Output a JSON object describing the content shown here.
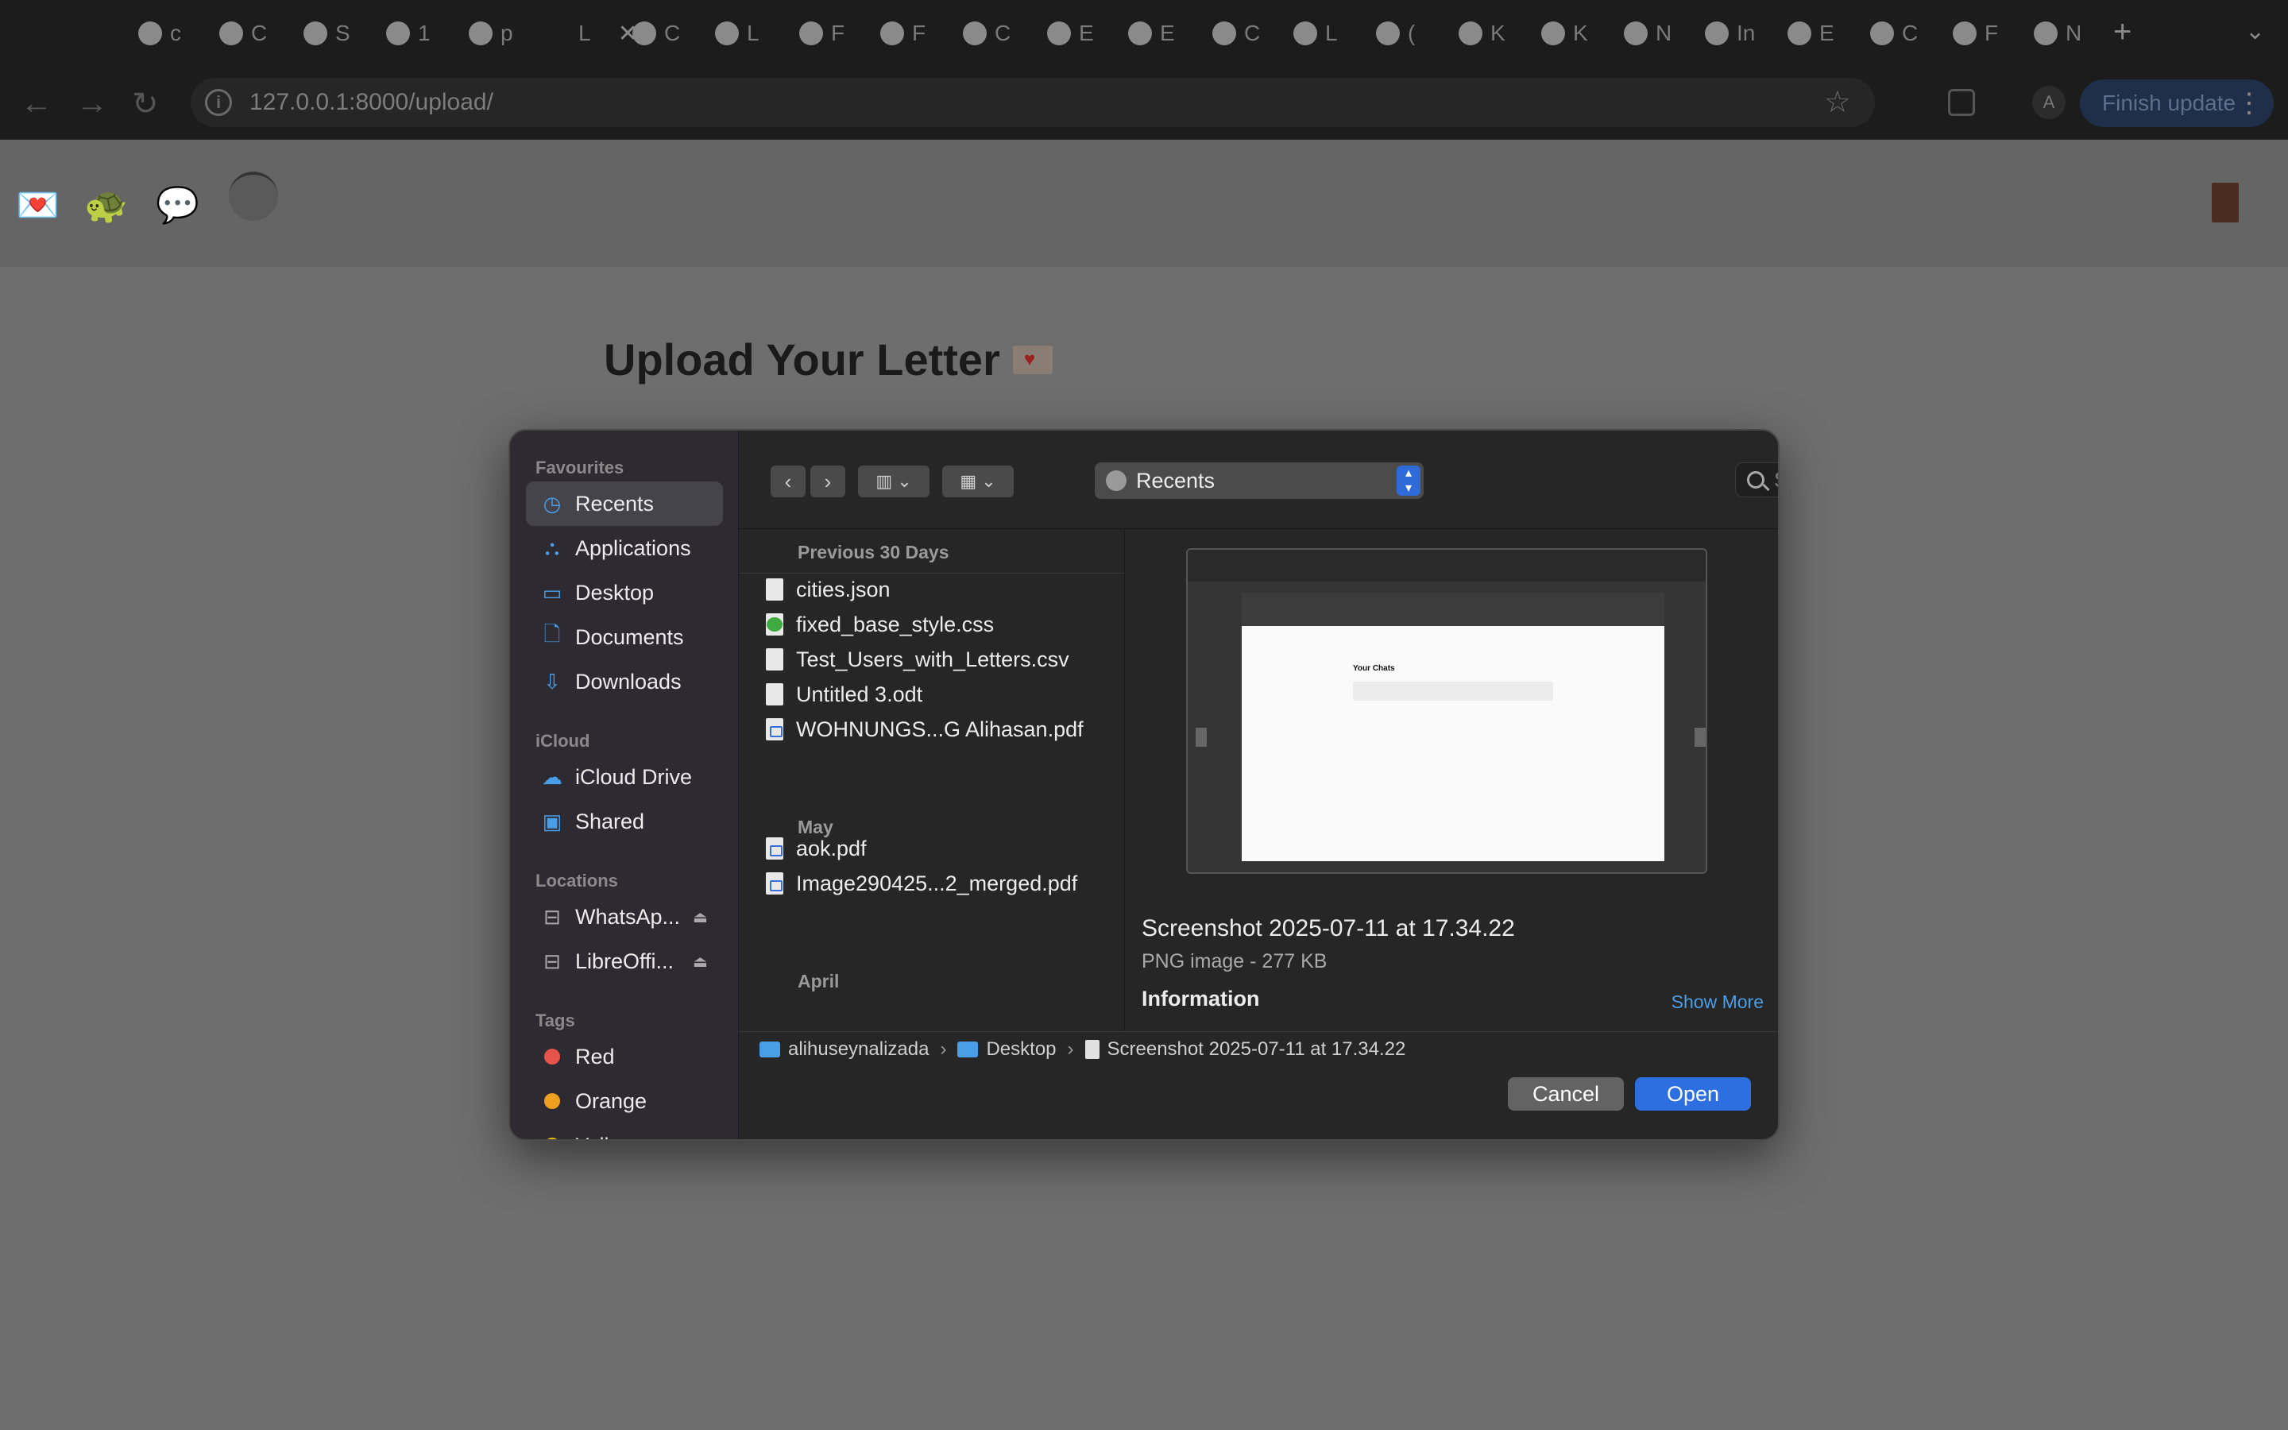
{
  "browser": {
    "tabs": [
      {
        "initial": "c"
      },
      {
        "initial": "C"
      },
      {
        "initial": "S"
      },
      {
        "initial": "1"
      },
      {
        "initial": "p"
      },
      {
        "initial": "L"
      },
      {
        "initial": "C"
      },
      {
        "initial": "L"
      },
      {
        "initial": "F"
      },
      {
        "initial": "F"
      },
      {
        "initial": "C"
      },
      {
        "initial": "E"
      },
      {
        "initial": "E"
      },
      {
        "initial": "C"
      },
      {
        "initial": "L"
      },
      {
        "initial": "("
      },
      {
        "initial": "K"
      },
      {
        "initial": "K"
      },
      {
        "initial": "N"
      },
      {
        "initial": "In"
      },
      {
        "initial": "E"
      },
      {
        "initial": "C"
      },
      {
        "initial": "F"
      },
      {
        "initial": "N"
      }
    ],
    "active_tab_close": "✕",
    "new_tab": "+",
    "tab_menu": "⌄",
    "back": "←",
    "forward": "→",
    "reload": "↻",
    "url": "127.0.0.1:8000/upload/",
    "site_info_icon": "i",
    "bookmark_star": "☆",
    "profile_initial": "A",
    "finish_update_label": "Finish update",
    "menu_dots": "⋮"
  },
  "page": {
    "title": "Upload Your Letter"
  },
  "dialog": {
    "sidebar": {
      "favourites_heading": "Favourites",
      "favourites": [
        {
          "label": "Recents",
          "icon": "clock-icon",
          "glyph": "◷"
        },
        {
          "label": "Applications",
          "icon": "applications-icon",
          "glyph": "⛬"
        },
        {
          "label": "Desktop",
          "icon": "desktop-icon",
          "glyph": "▭"
        },
        {
          "label": "Documents",
          "icon": "documents-icon",
          "glyph": "🗋"
        },
        {
          "label": "Downloads",
          "icon": "downloads-icon",
          "glyph": "⇩"
        }
      ],
      "icloud_heading": "iCloud",
      "icloud": [
        {
          "label": "iCloud Drive",
          "icon": "cloud-icon",
          "glyph": "☁"
        },
        {
          "label": "Shared",
          "icon": "shared-folder-icon",
          "glyph": "▣"
        }
      ],
      "locations_heading": "Locations",
      "locations": [
        {
          "label": "WhatsAp...",
          "icon": "drive-icon",
          "glyph": "⊟",
          "eject": "⏏"
        },
        {
          "label": "LibreOffi...",
          "icon": "drive-icon",
          "glyph": "⊟",
          "eject": "⏏"
        }
      ],
      "tags_heading": "Tags",
      "tags": [
        {
          "label": "Red",
          "color": "#e5534b"
        },
        {
          "label": "Orange",
          "color": "#f0a020"
        },
        {
          "label": "Yellow",
          "color": "#f2c200"
        }
      ]
    },
    "toolbar": {
      "back": "‹",
      "forward": "›",
      "column_view": "▥ ⌄",
      "group_view": "▦ ⌄",
      "location": "Recents",
      "location_arrows": "▴\n▾",
      "search_placeholder": "Search"
    },
    "files": {
      "groups": [
        {
          "heading": "Previous 30 Days",
          "items": [
            {
              "name": "cities.json",
              "type": "doc"
            },
            {
              "name": "fixed_base_style.css",
              "type": "css"
            },
            {
              "name": "Test_Users_with_Letters.csv",
              "type": "doc"
            },
            {
              "name": "Untitled 3.odt",
              "type": "doc"
            },
            {
              "name": "WOHNUNGS...G Alihasan.pdf",
              "type": "pdf"
            }
          ]
        },
        {
          "heading": "May",
          "items": [
            {
              "name": "aok.pdf",
              "type": "pdf"
            },
            {
              "name": "Image290425...2_merged.pdf",
              "type": "pdf"
            }
          ]
        },
        {
          "heading": "April",
          "items": []
        }
      ]
    },
    "preview": {
      "thumb_title": "Your Chats",
      "filename": "Screenshot 2025-07-11 at 17.34.22",
      "kind": "PNG image - 277 KB",
      "info_heading": "Information",
      "show_more": "Show More"
    },
    "path": [
      {
        "label": "alihuseynalizada",
        "icon": "folder-icon"
      },
      {
        "label": "Desktop",
        "icon": "folder-icon"
      },
      {
        "label": "Screenshot 2025-07-11 at 17.34.22",
        "icon": "document-icon"
      }
    ],
    "path_separator": "›",
    "cancel_label": "Cancel",
    "open_label": "Open",
    "accent_color": "#2d6ee0"
  }
}
